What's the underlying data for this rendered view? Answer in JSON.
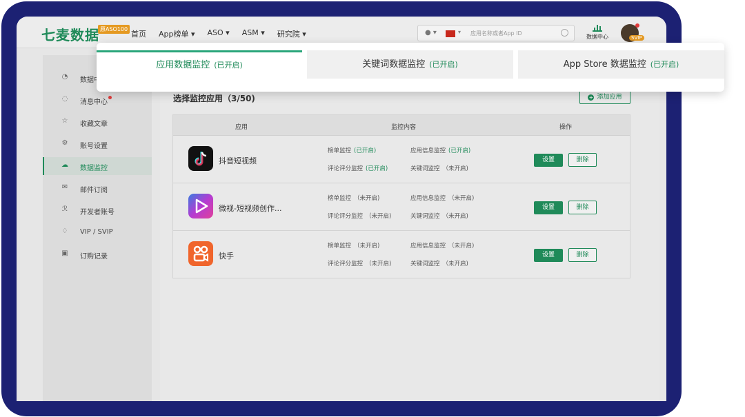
{
  "brand": {
    "logo": "七麦数据",
    "badge": "原ASO100"
  },
  "nav": [
    "首页",
    "App榜单 ▾",
    "ASO ▾",
    "ASM ▾",
    "研究院 ▾"
  ],
  "search": {
    "placeholder": "应用名称或者App ID",
    "store_glyph": "● ▾",
    "flag_caret": "▾"
  },
  "header": {
    "data_center": "数据中心",
    "vip_badge": "SVIP"
  },
  "sidebar": [
    {
      "label": "数据中",
      "icon": "pie-chart-icon"
    },
    {
      "label": "消息中心",
      "icon": "message-icon",
      "dot": true
    },
    {
      "label": "收藏文章",
      "icon": "star-icon"
    },
    {
      "label": "账号设置",
      "icon": "gear-icon"
    },
    {
      "label": "数据监控",
      "icon": "cloud-icon",
      "active": true
    },
    {
      "label": "邮件订阅",
      "icon": "mail-icon"
    },
    {
      "label": "开发者账号",
      "icon": "user-icon"
    },
    {
      "label": "VIP / SVIP",
      "icon": "diamond-icon"
    },
    {
      "label": "订购记录",
      "icon": "receipt-icon"
    }
  ],
  "tabs": [
    {
      "label": "应用数据监控",
      "status": "(已开启)",
      "active": true
    },
    {
      "label": "关键词数据监控",
      "status": "(已开启)",
      "active": false
    },
    {
      "label": "App Store 数据监控",
      "status": "(已开启)",
      "active": false
    }
  ],
  "section": {
    "title": "选择监控应用（3/50)",
    "add_button": "添加应用",
    "add_glyph": "+"
  },
  "table": {
    "headers": {
      "app": "应用",
      "content": "监控内容",
      "action": "操作"
    },
    "set_label": "设置",
    "delete_label": "删除",
    "rows": [
      {
        "name": "抖音短视频",
        "icon_color": "#111111",
        "items": [
          {
            "label": "榜单监控",
            "status": "(已开启)",
            "on": true
          },
          {
            "label": "应用信息监控",
            "status": "(已开启)",
            "on": true
          },
          {
            "label": "评论评分监控",
            "status": "(已开启)",
            "on": true
          },
          {
            "label": "关键词监控",
            "status": "（未开启)",
            "on": false
          }
        ]
      },
      {
        "name": "微视-短视频创作...",
        "icon_color": "#6a3fd0",
        "items": [
          {
            "label": "榜单监控",
            "status": "（未开启)",
            "on": false
          },
          {
            "label": "应用信息监控",
            "status": "（未开启)",
            "on": false
          },
          {
            "label": "评论评分监控",
            "status": "（未开启)",
            "on": false
          },
          {
            "label": "关键词监控",
            "status": "（未开启)",
            "on": false
          }
        ]
      },
      {
        "name": "快手",
        "icon_color": "#f0652c",
        "items": [
          {
            "label": "榜单监控",
            "status": "（未开启)",
            "on": false
          },
          {
            "label": "应用信息监控",
            "status": "（未开启)",
            "on": false
          },
          {
            "label": "评论评分监控",
            "status": "（未开启)",
            "on": false
          },
          {
            "label": "关键词监控",
            "status": "（未开启)",
            "on": false
          }
        ]
      }
    ]
  },
  "colors": {
    "accent": "#1f8a59",
    "frame": "#1c2173",
    "vip": "#e59a22"
  }
}
